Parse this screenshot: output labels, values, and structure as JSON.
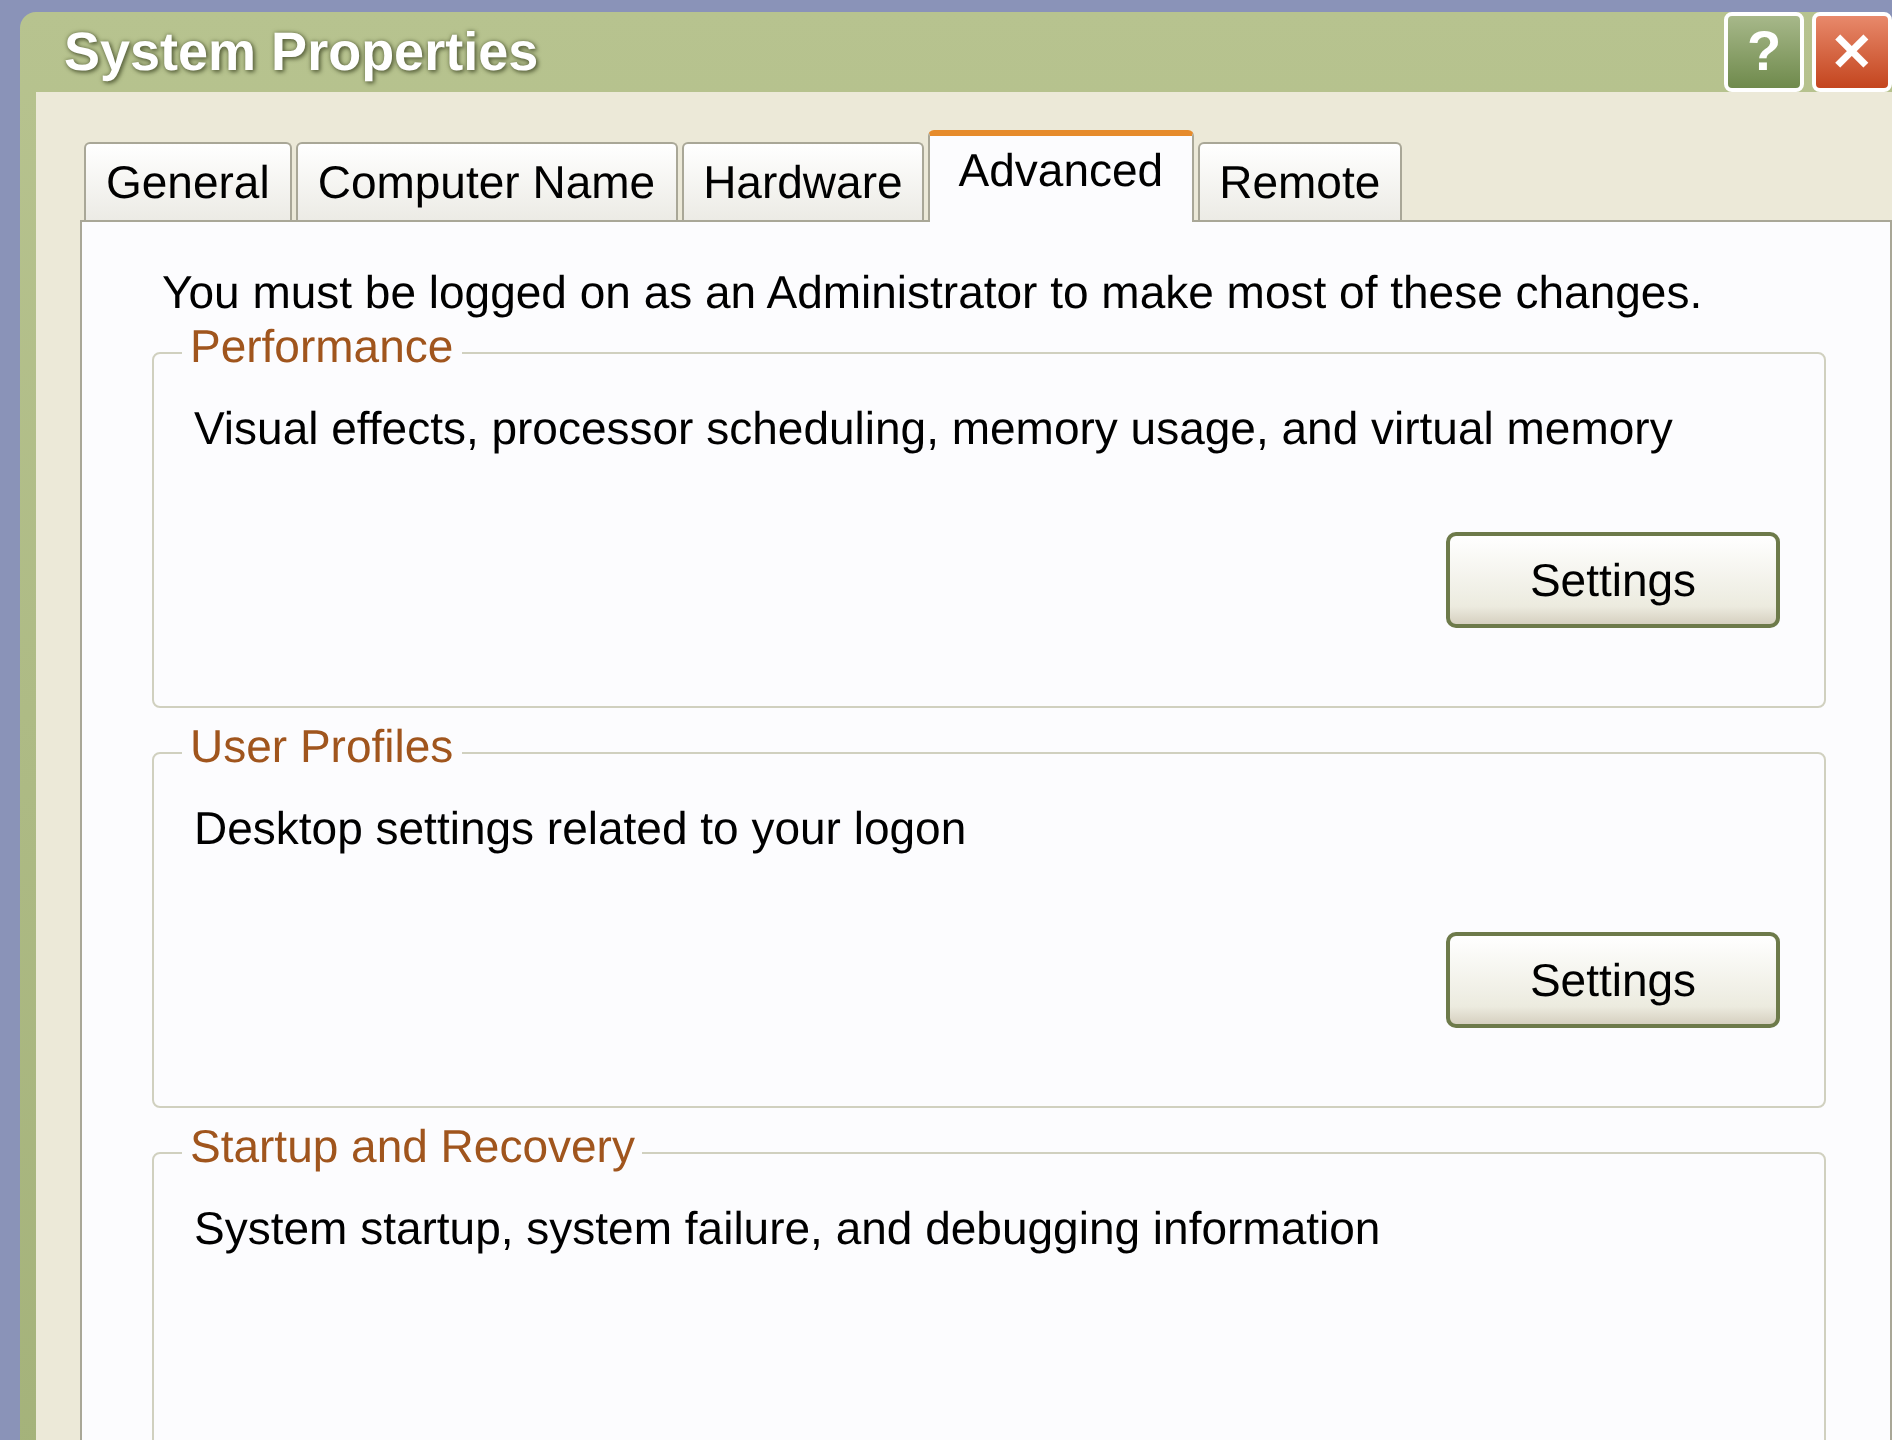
{
  "window": {
    "title": "System Properties",
    "help_button": "?",
    "close_button": "✕"
  },
  "tabs": [
    {
      "label": "General",
      "selected": false
    },
    {
      "label": "Computer Name",
      "selected": false
    },
    {
      "label": "Hardware",
      "selected": false
    },
    {
      "label": "Advanced",
      "selected": true
    },
    {
      "label": "Remote",
      "selected": false
    }
  ],
  "notice": "You must be logged on as an Administrator to make most of these changes.",
  "groups": [
    {
      "title": "Performance",
      "description": "Visual effects, processor scheduling, memory usage, and virtual memory",
      "button": "Settings"
    },
    {
      "title": "User Profiles",
      "description": "Desktop settings related to your logon",
      "button": "Settings"
    },
    {
      "title": "Startup and Recovery",
      "description": "System startup, system failure, and debugging information"
    }
  ]
}
